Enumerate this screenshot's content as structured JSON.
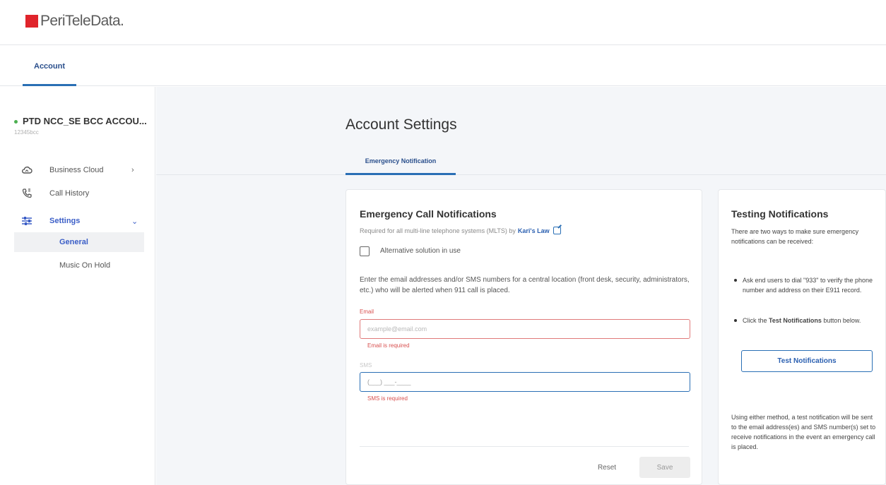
{
  "brand": {
    "logo_text": "PeriTeleData."
  },
  "top_tabs": [
    {
      "label": "Account"
    }
  ],
  "sidebar": {
    "account_name": "PTD NCC_SE BCC ACCOU...",
    "account_number": "12345bcc",
    "nav": [
      {
        "label": "Business Cloud",
        "icon": "cloud-icon"
      },
      {
        "label": "Call History",
        "icon": "phone-history-icon"
      },
      {
        "label": "Settings",
        "icon": "settings-sliders-icon"
      }
    ],
    "sub_items": [
      {
        "label": "General"
      },
      {
        "label": "Music On Hold"
      }
    ]
  },
  "main": {
    "title": "Account Settings",
    "tabs": [
      {
        "label": "Emergency Notification"
      }
    ]
  },
  "ecn": {
    "title": "Emergency Call Notifications",
    "subtitle": "Required for all multi-line telephone systems (MLTS) by",
    "link": "Kari's Law",
    "checkbox_label": "Alternative solution in use",
    "description": "Enter the email addresses and/or SMS numbers for a central location (front desk, security, administrators, etc.) who will be alerted when 911 call is placed.",
    "email": {
      "label": "Email",
      "placeholder": "example@email.com",
      "error": "Email is required"
    },
    "sms": {
      "label": "SMS",
      "value": "(___) ___-____",
      "error": "SMS is required"
    },
    "reset_label": "Reset",
    "save_label": "Save"
  },
  "testing": {
    "title": "Testing Notifications",
    "intro": "There are two ways to make sure emergency notifications can be received:",
    "bullet1": "Ask end users to dial \"933\" to verify the phone number and address on their E911 record.",
    "bullet2_pre": "Click the ",
    "bullet2_bold": "Test Notifications",
    "bullet2_post": " button below.",
    "button_label": "Test Notifications",
    "footer": "Using either method, a test notification will be sent to the email address(es) and SMS number(s) set to receive notifications in the event an emergency call is placed."
  },
  "colors": {
    "brand_red": "#e0242b",
    "accent_blue": "#2a6fb5",
    "error_red": "#d8504f",
    "active_nav": "#3b5ec7",
    "status_green": "#4caf50"
  }
}
